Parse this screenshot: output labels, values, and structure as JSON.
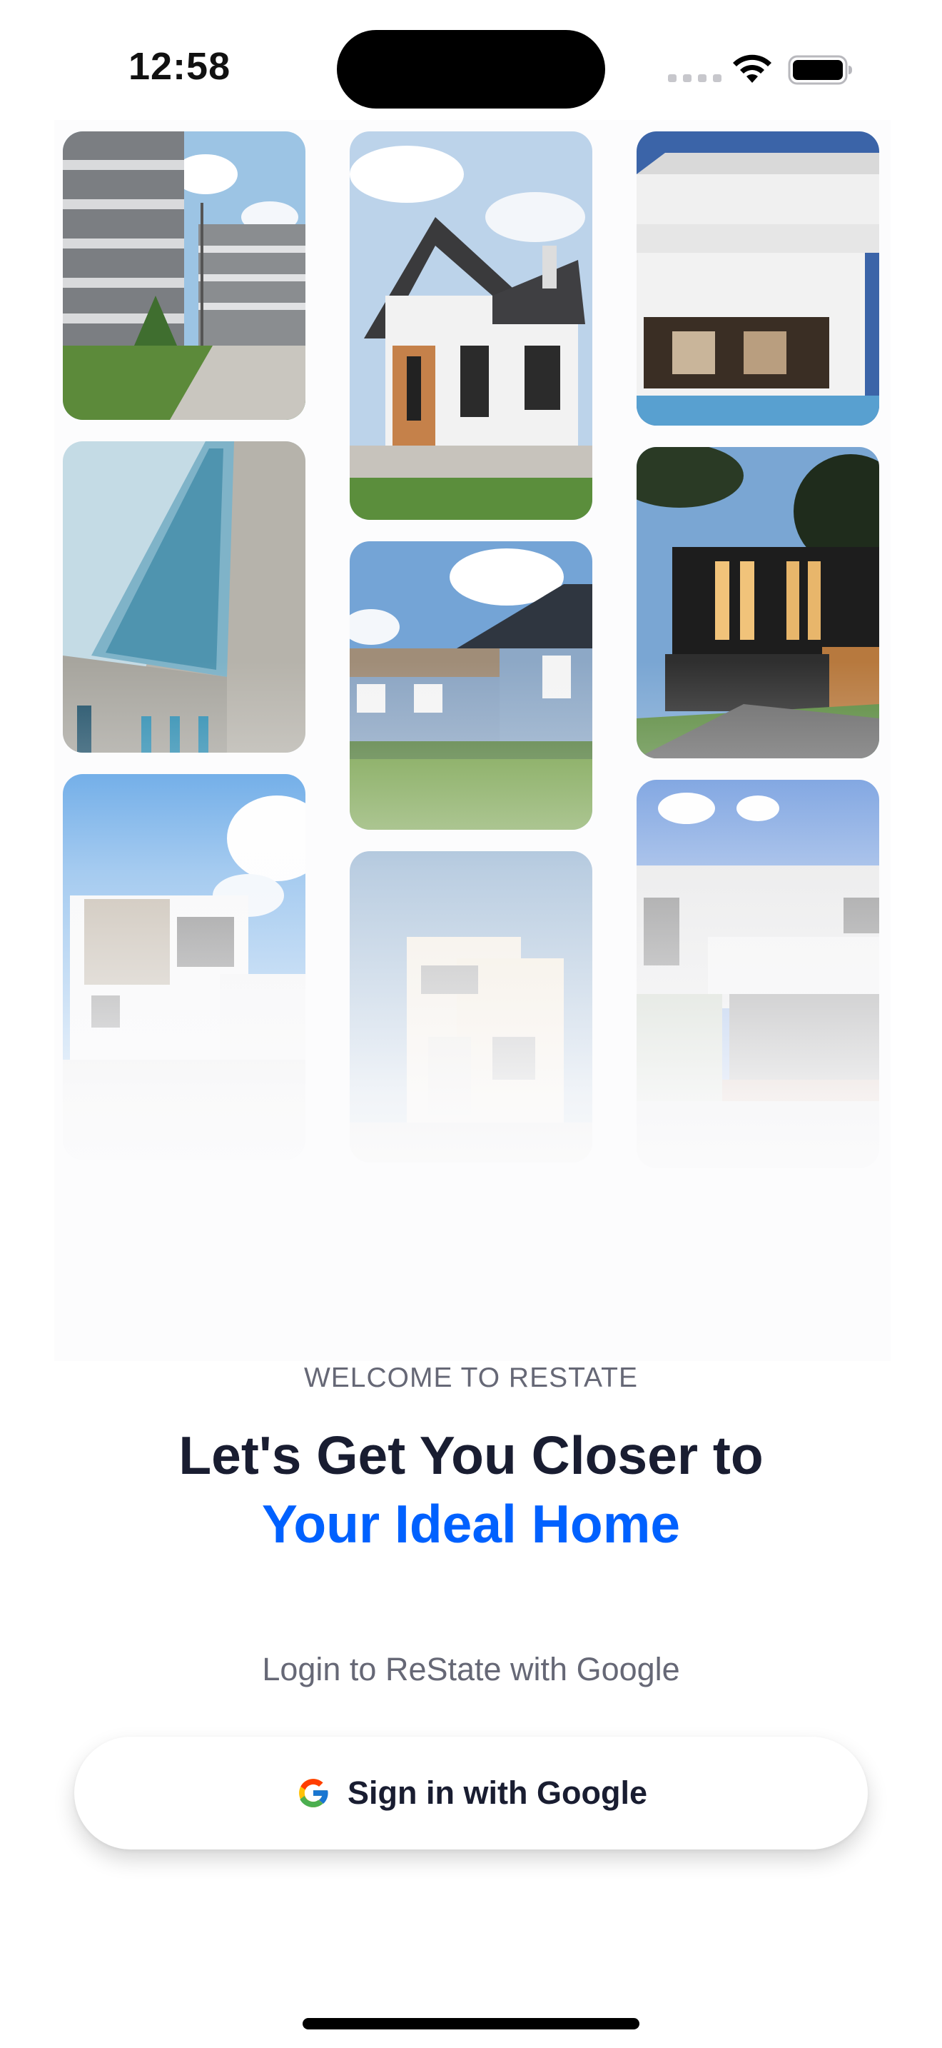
{
  "status_bar": {
    "time": "12:58",
    "icons": [
      "cellular-signal-icon",
      "wifi-icon",
      "battery-icon"
    ]
  },
  "gallery": {
    "columns": [
      [
        {
          "name": "apartment-complex-photo"
        },
        {
          "name": "modern-angular-building-photo"
        },
        {
          "name": "white-brick-house-photo"
        }
      ],
      [
        {
          "name": "gabled-white-house-photo"
        },
        {
          "name": "blue-wooden-house-photo"
        },
        {
          "name": "cream-cube-house-photo"
        }
      ],
      [
        {
          "name": "white-villa-pool-photo"
        },
        {
          "name": "dark-modern-house-photo"
        },
        {
          "name": "white-glass-house-photo"
        }
      ]
    ]
  },
  "welcome": {
    "eyebrow": "WELCOME TO RESTATE",
    "headline_line1": "Let's Get You Closer to",
    "headline_line2": "Your Ideal Home",
    "subtitle": "Login to ReState with Google"
  },
  "google_button": {
    "label": "Sign in with Google",
    "icon": "google-icon"
  },
  "colors": {
    "accent": "#0061FF",
    "heading": "#191D31",
    "muted": "#666876",
    "background": "#FFFFFF"
  }
}
